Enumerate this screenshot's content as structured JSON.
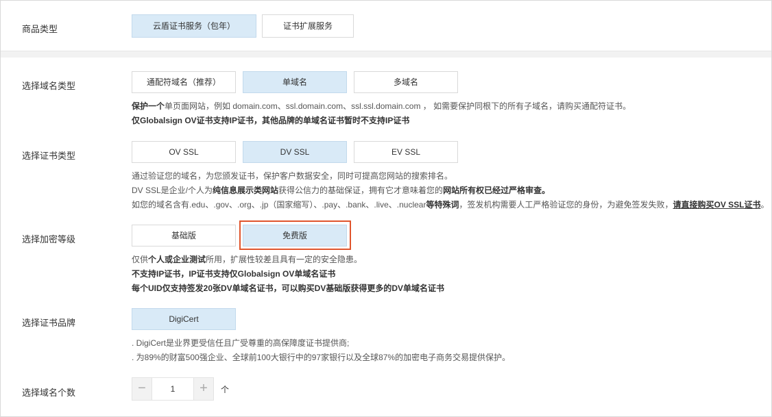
{
  "product_type": {
    "label": "商品类型",
    "options": [
      {
        "label": "云盾证书服务（包年）",
        "selected": true
      },
      {
        "label": "证书扩展服务",
        "selected": false
      }
    ]
  },
  "domain_type": {
    "label": "选择域名类型",
    "options": [
      {
        "label": "通配符域名（推荐）",
        "selected": false
      },
      {
        "label": "单域名",
        "selected": true
      },
      {
        "label": "多域名",
        "selected": false
      }
    ],
    "desc": {
      "line1_bold": "保护一个",
      "line1_rest": "单页面网站，例如 domain.com、ssl.domain.com、ssl.ssl.domain.com ， 如需要保护同根下的所有子域名，请购买通配符证书。",
      "line2": "仅Globalsign OV证书支持IP证书，其他品牌的单域名证书暂时不支持IP证书"
    }
  },
  "cert_type": {
    "label": "选择证书类型",
    "options": [
      {
        "label": "OV SSL",
        "selected": false
      },
      {
        "label": "DV SSL",
        "selected": true
      },
      {
        "label": "EV SSL",
        "selected": false
      }
    ],
    "desc": {
      "line1": "通过验证您的域名，为您颁发证书，保护客户数据安全，同时可提高您网站的搜索排名。",
      "line2_a": "DV SSL是企业/个人为",
      "line2_b": "纯信息展示类网站",
      "line2_c": "获得公信力的基础保证，拥有它才意味着您的",
      "line2_d": "网站所有权已经过严格审查。",
      "line3_a": "如您的域名含有.edu、.gov、.org、.jp（国家缩写）、.pay、.bank、.live、.nuclear",
      "line3_b": "等特殊词",
      "line3_c": "，签发机构需要人工严格验证您的身份，为避免签发失败，",
      "line3_link": "请直接购买OV SSL证书",
      "line3_end": "。"
    }
  },
  "encryption_level": {
    "label": "选择加密等级",
    "options": [
      {
        "label": "基础版",
        "selected": false
      },
      {
        "label": "免费版",
        "selected": true
      }
    ],
    "desc": {
      "line1_a": "仅供",
      "line1_b": "个人或企业测试",
      "line1_c": "所用，扩展性较差且具有一定的安全隐患。",
      "line2": "不支持IP证书，IP证书支持仅Globalsign OV单域名证书",
      "line3": "每个UID仅支持签发20张DV单域名证书，可以购买DV基础版获得更多的DV单域名证书"
    }
  },
  "cert_brand": {
    "label": "选择证书品牌",
    "options": [
      {
        "label": "DigiCert",
        "selected": true
      }
    ],
    "desc": {
      "line1": ". DigiCert是业界更受信任且广受尊重的高保障度证书提供商;",
      "line2": ". 为89%的财富500强企业、全球前100大银行中的97家银行以及全球87%的加密电子商务交易提供保护。"
    }
  },
  "domain_count": {
    "label": "选择域名个数",
    "value": "1",
    "minus": "−",
    "plus": "+",
    "unit": "个"
  },
  "colors": {
    "selected_bg": "#d9eaf7",
    "highlight": "#e0542c"
  }
}
